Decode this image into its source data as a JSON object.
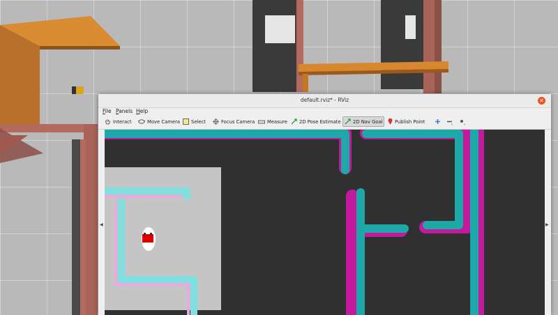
{
  "window": {
    "title": "default.rviz* - RViz",
    "close_icon": "close-icon",
    "accent": "#e95420"
  },
  "menubar": {
    "items": [
      {
        "label": "File"
      },
      {
        "label": "Panels"
      },
      {
        "label": "Help"
      }
    ]
  },
  "toolbar": {
    "tools": [
      {
        "label": "Interact",
        "icon": "hand-icon"
      },
      {
        "label": "Move Camera",
        "icon": "move-camera-icon"
      },
      {
        "label": "Select",
        "icon": "select-icon"
      },
      {
        "label": "Focus Camera",
        "icon": "focus-camera-icon"
      },
      {
        "label": "Measure",
        "icon": "ruler-icon"
      },
      {
        "label": "2D Pose Estimate",
        "icon": "green-arrow-icon"
      },
      {
        "label": "2D Nav Goal",
        "icon": "green-arrow-icon",
        "active": true
      },
      {
        "label": "Publish Point",
        "icon": "map-pin-icon"
      }
    ],
    "extra_icons": [
      "add-tool-icon",
      "remove-tool-icon",
      "tool-options-icon"
    ]
  },
  "viewport": {
    "map_background": "#303030",
    "path_color": "#1fa8a8",
    "inflation_color": "#c21a9c",
    "robot_color": "#dd0000"
  }
}
